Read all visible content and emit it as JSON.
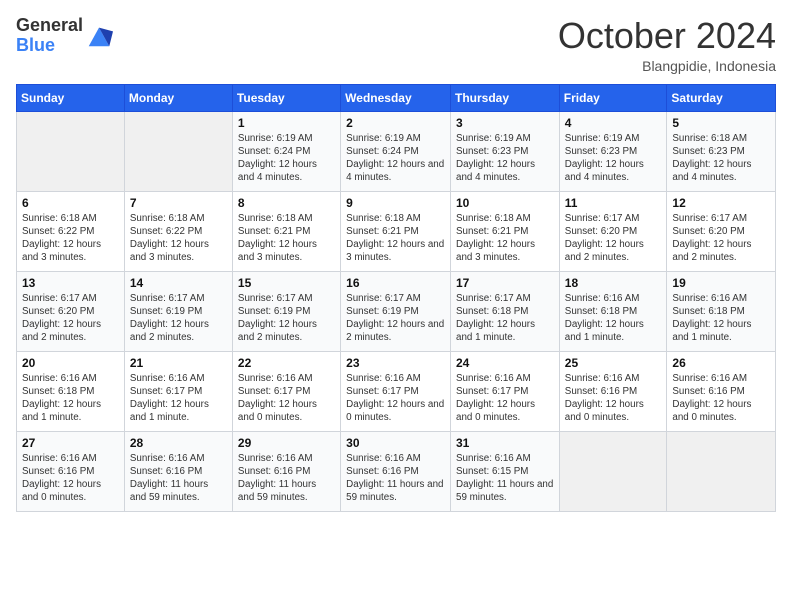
{
  "logo": {
    "general": "General",
    "blue": "Blue"
  },
  "header": {
    "month": "October 2024",
    "location": "Blangpidie, Indonesia"
  },
  "weekdays": [
    "Sunday",
    "Monday",
    "Tuesday",
    "Wednesday",
    "Thursday",
    "Friday",
    "Saturday"
  ],
  "weeks": [
    [
      {
        "day": null
      },
      {
        "day": null
      },
      {
        "day": 1,
        "sunrise": "6:19 AM",
        "sunset": "6:24 PM",
        "daylight": "12 hours and 4 minutes."
      },
      {
        "day": 2,
        "sunrise": "6:19 AM",
        "sunset": "6:24 PM",
        "daylight": "12 hours and 4 minutes."
      },
      {
        "day": 3,
        "sunrise": "6:19 AM",
        "sunset": "6:23 PM",
        "daylight": "12 hours and 4 minutes."
      },
      {
        "day": 4,
        "sunrise": "6:19 AM",
        "sunset": "6:23 PM",
        "daylight": "12 hours and 4 minutes."
      },
      {
        "day": 5,
        "sunrise": "6:18 AM",
        "sunset": "6:23 PM",
        "daylight": "12 hours and 4 minutes."
      }
    ],
    [
      {
        "day": 6,
        "sunrise": "6:18 AM",
        "sunset": "6:22 PM",
        "daylight": "12 hours and 3 minutes."
      },
      {
        "day": 7,
        "sunrise": "6:18 AM",
        "sunset": "6:22 PM",
        "daylight": "12 hours and 3 minutes."
      },
      {
        "day": 8,
        "sunrise": "6:18 AM",
        "sunset": "6:21 PM",
        "daylight": "12 hours and 3 minutes."
      },
      {
        "day": 9,
        "sunrise": "6:18 AM",
        "sunset": "6:21 PM",
        "daylight": "12 hours and 3 minutes."
      },
      {
        "day": 10,
        "sunrise": "6:18 AM",
        "sunset": "6:21 PM",
        "daylight": "12 hours and 3 minutes."
      },
      {
        "day": 11,
        "sunrise": "6:17 AM",
        "sunset": "6:20 PM",
        "daylight": "12 hours and 2 minutes."
      },
      {
        "day": 12,
        "sunrise": "6:17 AM",
        "sunset": "6:20 PM",
        "daylight": "12 hours and 2 minutes."
      }
    ],
    [
      {
        "day": 13,
        "sunrise": "6:17 AM",
        "sunset": "6:20 PM",
        "daylight": "12 hours and 2 minutes."
      },
      {
        "day": 14,
        "sunrise": "6:17 AM",
        "sunset": "6:19 PM",
        "daylight": "12 hours and 2 minutes."
      },
      {
        "day": 15,
        "sunrise": "6:17 AM",
        "sunset": "6:19 PM",
        "daylight": "12 hours and 2 minutes."
      },
      {
        "day": 16,
        "sunrise": "6:17 AM",
        "sunset": "6:19 PM",
        "daylight": "12 hours and 2 minutes."
      },
      {
        "day": 17,
        "sunrise": "6:17 AM",
        "sunset": "6:18 PM",
        "daylight": "12 hours and 1 minute."
      },
      {
        "day": 18,
        "sunrise": "6:16 AM",
        "sunset": "6:18 PM",
        "daylight": "12 hours and 1 minute."
      },
      {
        "day": 19,
        "sunrise": "6:16 AM",
        "sunset": "6:18 PM",
        "daylight": "12 hours and 1 minute."
      }
    ],
    [
      {
        "day": 20,
        "sunrise": "6:16 AM",
        "sunset": "6:18 PM",
        "daylight": "12 hours and 1 minute."
      },
      {
        "day": 21,
        "sunrise": "6:16 AM",
        "sunset": "6:17 PM",
        "daylight": "12 hours and 1 minute."
      },
      {
        "day": 22,
        "sunrise": "6:16 AM",
        "sunset": "6:17 PM",
        "daylight": "12 hours and 0 minutes."
      },
      {
        "day": 23,
        "sunrise": "6:16 AM",
        "sunset": "6:17 PM",
        "daylight": "12 hours and 0 minutes."
      },
      {
        "day": 24,
        "sunrise": "6:16 AM",
        "sunset": "6:17 PM",
        "daylight": "12 hours and 0 minutes."
      },
      {
        "day": 25,
        "sunrise": "6:16 AM",
        "sunset": "6:16 PM",
        "daylight": "12 hours and 0 minutes."
      },
      {
        "day": 26,
        "sunrise": "6:16 AM",
        "sunset": "6:16 PM",
        "daylight": "12 hours and 0 minutes."
      }
    ],
    [
      {
        "day": 27,
        "sunrise": "6:16 AM",
        "sunset": "6:16 PM",
        "daylight": "12 hours and 0 minutes."
      },
      {
        "day": 28,
        "sunrise": "6:16 AM",
        "sunset": "6:16 PM",
        "daylight": "11 hours and 59 minutes."
      },
      {
        "day": 29,
        "sunrise": "6:16 AM",
        "sunset": "6:16 PM",
        "daylight": "11 hours and 59 minutes."
      },
      {
        "day": 30,
        "sunrise": "6:16 AM",
        "sunset": "6:16 PM",
        "daylight": "11 hours and 59 minutes."
      },
      {
        "day": 31,
        "sunrise": "6:16 AM",
        "sunset": "6:15 PM",
        "daylight": "11 hours and 59 minutes."
      },
      {
        "day": null
      },
      {
        "day": null
      }
    ]
  ],
  "labels": {
    "sunrise": "Sunrise:",
    "sunset": "Sunset:",
    "daylight": "Daylight:"
  }
}
